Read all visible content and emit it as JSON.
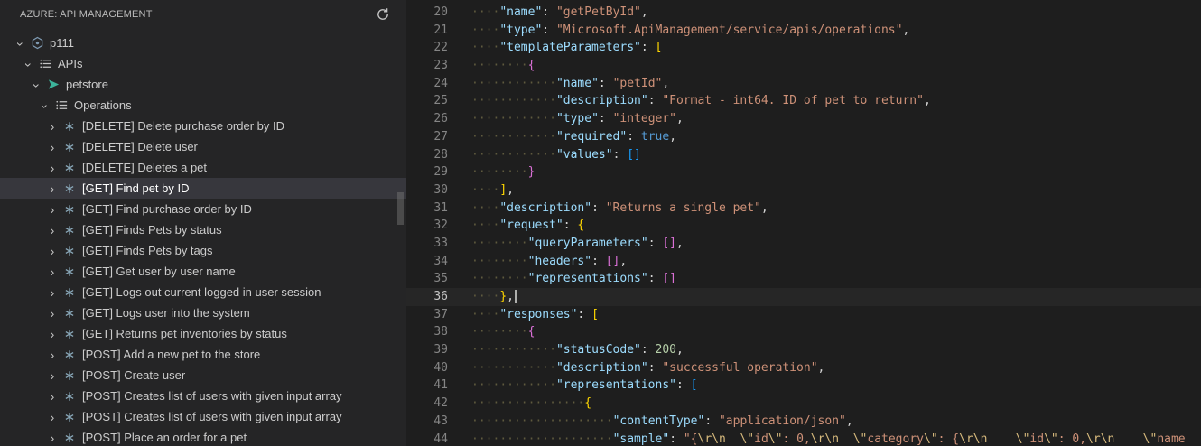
{
  "sidebar": {
    "header": {
      "title": "AZURE: API MANAGEMENT",
      "refresh_icon": "refresh-icon"
    },
    "tree": [
      {
        "label": "p111",
        "icon": "apim-service-icon",
        "expanded": true
      },
      {
        "label": "APIs",
        "icon": "list-icon",
        "expanded": true
      },
      {
        "label": "petstore",
        "icon": "api-icon",
        "expanded": true
      },
      {
        "label": "Operations",
        "icon": "list-icon",
        "expanded": true
      }
    ],
    "operations": [
      {
        "label": "[DELETE] Delete purchase order by ID",
        "selected": false
      },
      {
        "label": "[DELETE] Delete user",
        "selected": false
      },
      {
        "label": "[DELETE] Deletes a pet",
        "selected": false
      },
      {
        "label": "[GET] Find pet by ID",
        "selected": true
      },
      {
        "label": "[GET] Find purchase order by ID",
        "selected": false
      },
      {
        "label": "[GET] Finds Pets by status",
        "selected": false
      },
      {
        "label": "[GET] Finds Pets by tags",
        "selected": false
      },
      {
        "label": "[GET] Get user by user name",
        "selected": false
      },
      {
        "label": "[GET] Logs out current logged in user session",
        "selected": false
      },
      {
        "label": "[GET] Logs user into the system",
        "selected": false
      },
      {
        "label": "[GET] Returns pet inventories by status",
        "selected": false
      },
      {
        "label": "[POST] Add a new pet to the store",
        "selected": false
      },
      {
        "label": "[POST] Create user",
        "selected": false
      },
      {
        "label": "[POST] Creates list of users with given input array",
        "selected": false
      },
      {
        "label": "[POST] Creates list of users with given input array",
        "selected": false
      },
      {
        "label": "[POST] Place an order for a pet",
        "selected": false
      }
    ]
  },
  "editor": {
    "language": "json",
    "first_visible_line": 20,
    "last_visible_line": 44,
    "active_line": 36,
    "lines": [
      {
        "n": 20,
        "indent": 1,
        "tokens": [
          [
            "key",
            "\"name\""
          ],
          [
            "p",
            ": "
          ],
          [
            "s",
            "\"getPetById\""
          ],
          [
            "p",
            ","
          ]
        ]
      },
      {
        "n": 21,
        "indent": 1,
        "tokens": [
          [
            "key",
            "\"type\""
          ],
          [
            "p",
            ": "
          ],
          [
            "s",
            "\"Microsoft.ApiManagement/service/apis/operations\""
          ],
          [
            "p",
            ","
          ]
        ]
      },
      {
        "n": 22,
        "indent": 1,
        "tokens": [
          [
            "key",
            "\"templateParameters\""
          ],
          [
            "p",
            ": "
          ],
          [
            "b1",
            "["
          ]
        ]
      },
      {
        "n": 23,
        "indent": 2,
        "tokens": [
          [
            "b2",
            "{"
          ]
        ]
      },
      {
        "n": 24,
        "indent": 3,
        "tokens": [
          [
            "key",
            "\"name\""
          ],
          [
            "p",
            ": "
          ],
          [
            "s",
            "\"petId\""
          ],
          [
            "p",
            ","
          ]
        ]
      },
      {
        "n": 25,
        "indent": 3,
        "tokens": [
          [
            "key",
            "\"description\""
          ],
          [
            "p",
            ": "
          ],
          [
            "s",
            "\"Format - int64. ID of pet to return\""
          ],
          [
            "p",
            ","
          ]
        ]
      },
      {
        "n": 26,
        "indent": 3,
        "tokens": [
          [
            "key",
            "\"type\""
          ],
          [
            "p",
            ": "
          ],
          [
            "s",
            "\"integer\""
          ],
          [
            "p",
            ","
          ]
        ]
      },
      {
        "n": 27,
        "indent": 3,
        "tokens": [
          [
            "key",
            "\"required\""
          ],
          [
            "p",
            ": "
          ],
          [
            "kw",
            "true"
          ],
          [
            "p",
            ","
          ]
        ]
      },
      {
        "n": 28,
        "indent": 3,
        "tokens": [
          [
            "key",
            "\"values\""
          ],
          [
            "p",
            ": "
          ],
          [
            "b3",
            "[]"
          ]
        ]
      },
      {
        "n": 29,
        "indent": 2,
        "tokens": [
          [
            "b2",
            "}"
          ]
        ]
      },
      {
        "n": 30,
        "indent": 1,
        "tokens": [
          [
            "b1",
            "]"
          ],
          [
            "p",
            ","
          ]
        ]
      },
      {
        "n": 31,
        "indent": 1,
        "tokens": [
          [
            "key",
            "\"description\""
          ],
          [
            "p",
            ": "
          ],
          [
            "s",
            "\"Returns a single pet\""
          ],
          [
            "p",
            ","
          ]
        ]
      },
      {
        "n": 32,
        "indent": 1,
        "tokens": [
          [
            "key",
            "\"request\""
          ],
          [
            "p",
            ": "
          ],
          [
            "b1",
            "{"
          ]
        ]
      },
      {
        "n": 33,
        "indent": 2,
        "tokens": [
          [
            "key",
            "\"queryParameters\""
          ],
          [
            "p",
            ": "
          ],
          [
            "b2",
            "[]"
          ],
          [
            "p",
            ","
          ]
        ]
      },
      {
        "n": 34,
        "indent": 2,
        "tokens": [
          [
            "key",
            "\"headers\""
          ],
          [
            "p",
            ": "
          ],
          [
            "b2",
            "[]"
          ],
          [
            "p",
            ","
          ]
        ]
      },
      {
        "n": 35,
        "indent": 2,
        "tokens": [
          [
            "key",
            "\"representations\""
          ],
          [
            "p",
            ": "
          ],
          [
            "b2",
            "[]"
          ]
        ]
      },
      {
        "n": 36,
        "indent": 1,
        "tokens": [
          [
            "b1",
            "}"
          ],
          [
            "p",
            ","
          ]
        ]
      },
      {
        "n": 37,
        "indent": 1,
        "tokens": [
          [
            "key",
            "\"responses\""
          ],
          [
            "p",
            ": "
          ],
          [
            "b1",
            "["
          ]
        ]
      },
      {
        "n": 38,
        "indent": 2,
        "tokens": [
          [
            "b2",
            "{"
          ]
        ]
      },
      {
        "n": 39,
        "indent": 3,
        "tokens": [
          [
            "key",
            "\"statusCode\""
          ],
          [
            "p",
            ": "
          ],
          [
            "n",
            "200"
          ],
          [
            "p",
            ","
          ]
        ]
      },
      {
        "n": 40,
        "indent": 3,
        "tokens": [
          [
            "key",
            "\"description\""
          ],
          [
            "p",
            ": "
          ],
          [
            "s",
            "\"successful operation\""
          ],
          [
            "p",
            ","
          ]
        ]
      },
      {
        "n": 41,
        "indent": 3,
        "tokens": [
          [
            "key",
            "\"representations\""
          ],
          [
            "p",
            ": "
          ],
          [
            "b3",
            "["
          ]
        ]
      },
      {
        "n": 42,
        "indent": 4,
        "tokens": [
          [
            "b1",
            "{"
          ]
        ]
      },
      {
        "n": 43,
        "indent": 5,
        "tokens": [
          [
            "key",
            "\"contentType\""
          ],
          [
            "p",
            ": "
          ],
          [
            "s",
            "\"application/json\""
          ],
          [
            "p",
            ","
          ]
        ]
      },
      {
        "n": 44,
        "indent": 5,
        "tokens": [
          [
            "key",
            "\"sample\""
          ],
          [
            "p",
            ": "
          ],
          [
            "s",
            "\"{"
          ],
          [
            "e",
            "\\r\\n"
          ],
          [
            "s",
            "  "
          ],
          [
            "e",
            "\\\""
          ],
          [
            "s",
            "id"
          ],
          [
            "e",
            "\\\""
          ],
          [
            "s",
            ": 0,"
          ],
          [
            "e",
            "\\r\\n"
          ],
          [
            "s",
            "  "
          ],
          [
            "e",
            "\\\""
          ],
          [
            "s",
            "category"
          ],
          [
            "e",
            "\\\""
          ],
          [
            "s",
            ": {"
          ],
          [
            "e",
            "\\r\\n"
          ],
          [
            "s",
            "    "
          ],
          [
            "e",
            "\\\""
          ],
          [
            "s",
            "id"
          ],
          [
            "e",
            "\\\""
          ],
          [
            "s",
            ": 0,"
          ],
          [
            "e",
            "\\r\\n"
          ],
          [
            "s",
            "    "
          ],
          [
            "e",
            "\\\""
          ],
          [
            "s",
            "name"
          ]
        ]
      }
    ]
  },
  "colors": {
    "editor_background": "#1e1e1e",
    "sidebar_background": "#252526",
    "selection_background": "#37373d",
    "key": "#9cdcfe",
    "string": "#ce9178",
    "escape": "#d7ba7d",
    "number": "#b5cea8",
    "boolean": "#569cd6",
    "bracket_gold": "#ffd700",
    "bracket_orchid": "#da70d6",
    "bracket_blue": "#179fff",
    "line_number": "#858585",
    "active_line_number": "#c6c6c6",
    "api_icon_teal": "#3cb39a",
    "service_icon_blue_gray": "#7f9bb3"
  }
}
